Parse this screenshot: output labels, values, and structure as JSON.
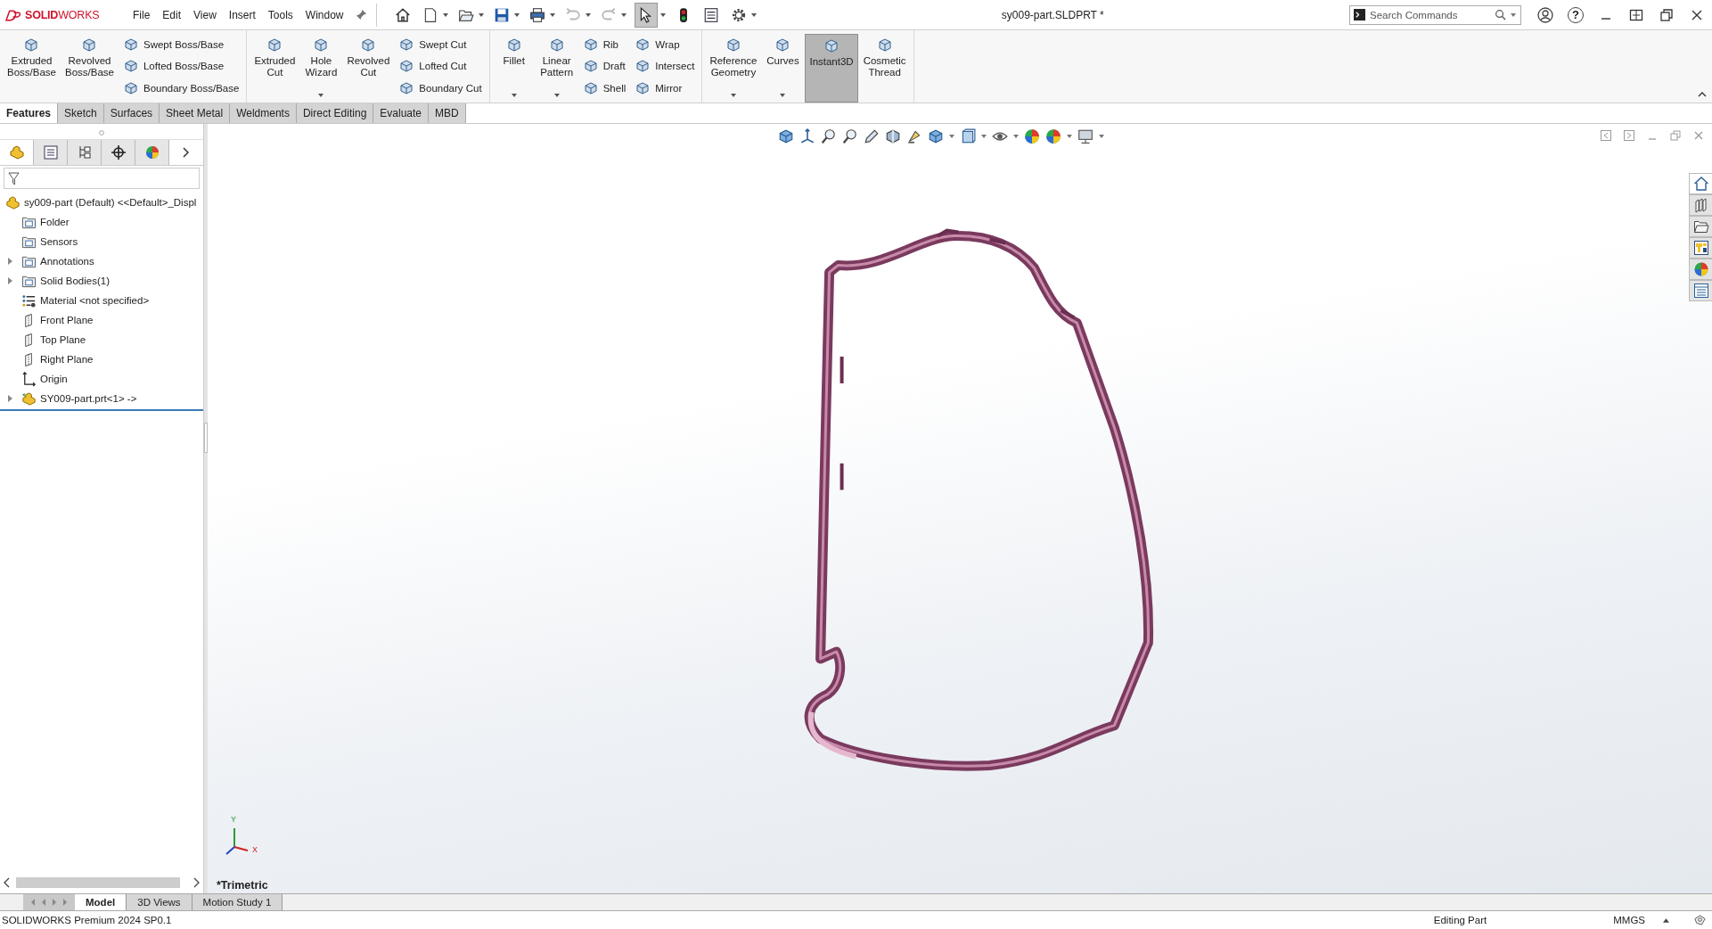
{
  "app": {
    "brand": "**SOLID**WORKS"
  },
  "menu": [
    {
      "label": "File"
    },
    {
      "label": "Edit"
    },
    {
      "label": "View"
    },
    {
      "label": "Insert"
    },
    {
      "label": "Tools"
    },
    {
      "label": "Window"
    }
  ],
  "window": {
    "title": "sy009-part.SLDPRT *"
  },
  "search": {
    "placeholder": "Search Commands"
  },
  "help": {
    "glyph": "?"
  },
  "ribbon": {
    "groups": [
      {
        "items": [
          {
            "kind": "large",
            "lines": [
              "Extruded",
              "Boss/Base"
            ],
            "dropdown": false,
            "on": false
          },
          {
            "kind": "large",
            "lines": [
              "Revolved",
              "Boss/Base"
            ],
            "dropdown": false,
            "on": false
          },
          {
            "kind": "stack",
            "items": [
              {
                "label": "Swept Boss/Base"
              },
              {
                "label": "Lofted Boss/Base"
              },
              {
                "label": "Boundary Boss/Base"
              }
            ]
          }
        ]
      },
      {
        "items": [
          {
            "kind": "large",
            "lines": [
              "Extruded",
              "Cut"
            ],
            "dropdown": false,
            "on": false
          },
          {
            "kind": "large",
            "lines": [
              "Hole",
              "Wizard"
            ],
            "dropdown": true,
            "on": false
          },
          {
            "kind": "large",
            "lines": [
              "Revolved",
              "Cut"
            ],
            "dropdown": false,
            "on": false
          },
          {
            "kind": "stack",
            "items": [
              {
                "label": "Swept Cut"
              },
              {
                "label": "Lofted Cut"
              },
              {
                "label": "Boundary Cut"
              }
            ]
          }
        ]
      },
      {
        "items": [
          {
            "kind": "large",
            "lines": [
              "Fillet"
            ],
            "dropdown": true,
            "on": false
          },
          {
            "kind": "large",
            "lines": [
              "Linear",
              "Pattern"
            ],
            "dropdown": true,
            "on": false
          },
          {
            "kind": "stack",
            "items": [
              {
                "label": "Rib"
              },
              {
                "label": "Draft"
              },
              {
                "label": "Shell"
              }
            ]
          },
          {
            "kind": "stack",
            "items": [
              {
                "label": "Wrap"
              },
              {
                "label": "Intersect"
              },
              {
                "label": "Mirror"
              }
            ]
          }
        ]
      },
      {
        "items": [
          {
            "kind": "large",
            "lines": [
              "Reference",
              "Geometry"
            ],
            "dropdown": true,
            "on": false
          },
          {
            "kind": "large",
            "lines": [
              "Curves"
            ],
            "dropdown": true,
            "on": false
          },
          {
            "kind": "large",
            "lines": [
              "Instant3D"
            ],
            "dropdown": false,
            "on": true
          },
          {
            "kind": "large",
            "lines": [
              "Cosmetic",
              "Thread"
            ],
            "dropdown": false,
            "on": false
          }
        ]
      }
    ]
  },
  "command_tabs": [
    {
      "label": "Features",
      "selected": true
    },
    {
      "label": "Sketch",
      "selected": false
    },
    {
      "label": "Surfaces",
      "selected": false
    },
    {
      "label": "Sheet Metal",
      "selected": false
    },
    {
      "label": "Weldments",
      "selected": false
    },
    {
      "label": "Direct Editing",
      "selected": false
    },
    {
      "label": "Evaluate",
      "selected": false
    },
    {
      "label": "MBD",
      "selected": false
    }
  ],
  "panel_tabs": [
    {
      "selected": true
    },
    {
      "selected": false
    },
    {
      "selected": false
    },
    {
      "selected": false
    },
    {
      "selected": false
    }
  ],
  "feature_tree": {
    "root": {
      "kind": "part",
      "label": "sy009-part (Default) <<Default>_Displ",
      "children": [
        {
          "kind": "folder",
          "label": "Folder",
          "expandable": false
        },
        {
          "kind": "folder",
          "label": "Sensors",
          "expandable": false
        },
        {
          "kind": "folder",
          "label": "Annotations",
          "expandable": true
        },
        {
          "kind": "folder",
          "label": "Solid Bodies(1)",
          "expandable": true
        },
        {
          "kind": "material",
          "label": "Material <not specified>",
          "expandable": false
        },
        {
          "kind": "plane",
          "label": "Front Plane",
          "expandable": false
        },
        {
          "kind": "plane",
          "label": "Top Plane",
          "expandable": false
        },
        {
          "kind": "plane",
          "label": "Right Plane",
          "expandable": false
        },
        {
          "kind": "origin",
          "label": "Origin",
          "expandable": false
        },
        {
          "kind": "part",
          "label": "SY009-part.prt<1> ->",
          "expandable": true
        }
      ]
    }
  },
  "viewport": {
    "view_label": "*Trimetric",
    "triad": {
      "y": "Y",
      "x": "X"
    }
  },
  "task_pane": [
    {
      "selected": true
    },
    {
      "selected": false
    },
    {
      "selected": false
    },
    {
      "selected": false
    },
    {
      "selected": false
    },
    {
      "selected": false
    }
  ],
  "bottom_tabs": [
    {
      "label": "Model",
      "selected": true
    },
    {
      "label": "3D Views",
      "selected": false
    },
    {
      "label": "Motion Study 1",
      "selected": false
    }
  ],
  "status_bar": {
    "product": "SOLIDWORKS Premium 2024 SP0.1",
    "mode": "Editing Part",
    "units": "MMGS"
  }
}
